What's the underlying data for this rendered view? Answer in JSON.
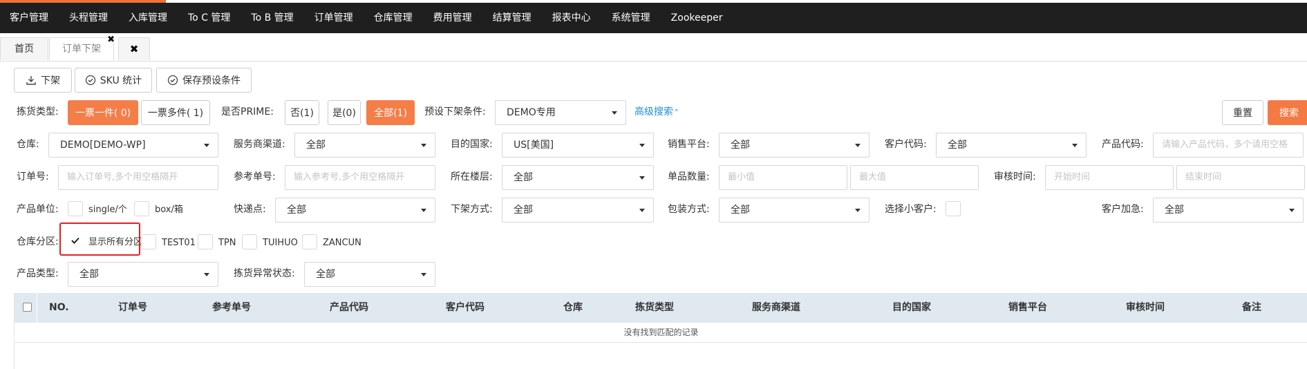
{
  "topnav": {
    "items": [
      "客户管理",
      "头程管理",
      "入库管理",
      "To C 管理",
      "To B 管理",
      "订单管理",
      "仓库管理",
      "费用管理",
      "结算管理",
      "报表中心",
      "系统管理",
      "Zookeeper"
    ]
  },
  "tabs": {
    "home": "首页",
    "current": "订单下架",
    "close_icon": "✖",
    "close_all": "✖"
  },
  "toolbar": {
    "offshelf": "下架",
    "sku_stats": "SKU 统计",
    "save_preset": "保存预设条件"
  },
  "filters": {
    "pick_type_label": "拣货类型:",
    "pick_type_options": [
      "一票一件( 0)",
      "一票多件( 1)"
    ],
    "prime_label": "是否PRIME:",
    "prime_options": [
      "否(1)",
      "是(0)",
      "全部(1)"
    ],
    "preset_label": "预设下架条件:",
    "preset_value": "DEMO专用",
    "advanced_search": "高级搜索",
    "reset": "重置",
    "search": "搜索",
    "warehouse_label": "仓库:",
    "warehouse_value": "DEMO[DEMO-WP]",
    "channel_label": "服务商渠道:",
    "channel_value": "全部",
    "country_label": "目的国家:",
    "country_value": "US[美国]",
    "platform_label": "销售平台:",
    "platform_value": "全部",
    "customer_code_label": "客户代码:",
    "customer_code_value": "全部",
    "product_code_label": "产品代码:",
    "product_code_placeholder": "请输入产品代码，多个请用空格",
    "order_no_label": "订单号:",
    "order_no_placeholder": "输入订单号,多个用空格隔开",
    "ref_no_label": "参考单号:",
    "ref_no_placeholder": "输入参考号,多个用空格隔开",
    "floor_label": "所在楼层:",
    "floor_value": "全部",
    "qty_label": "单品数量:",
    "qty_min_placeholder": "最小值",
    "qty_max_placeholder": "最大值",
    "audit_time_label": "审核时间:",
    "audit_start_placeholder": "开始时间",
    "audit_end_placeholder": "结束时间",
    "unit_label": "产品单位:",
    "unit_single": "single/个",
    "unit_box": "box/箱",
    "express_label": "快递点:",
    "express_value": "全部",
    "offshelf_method_label": "下架方式:",
    "offshelf_method_value": "全部",
    "pack_method_label": "包装方式:",
    "pack_method_value": "全部",
    "small_customer_label": "选择小客户:",
    "urgent_label": "客户加急:",
    "urgent_value": "全部",
    "zone_label": "仓库分区:",
    "zone_show_all": "显示所有分区",
    "zone_show_all_checked": true,
    "zones": [
      "TEST01",
      "TPN",
      "TUIHUO",
      "ZANCUN"
    ],
    "product_type_label": "产品类型:",
    "product_type_value": "全部",
    "pick_exception_label": "拣货异常状态:",
    "pick_exception_value": "全部"
  },
  "table": {
    "columns": [
      "NO.",
      "订单号",
      "参考单号",
      "产品代码",
      "客户代码",
      "仓库",
      "拣货类型",
      "服务商渠道",
      "目的国家",
      "销售平台",
      "审核时间",
      "备注"
    ],
    "empty_text": "没有找到匹配的记录"
  },
  "colors": {
    "accent": "#f57d47",
    "nav_bg": "#1f1f1f",
    "link": "#1e8fd4",
    "table_header": "#dfe9ef",
    "highlight": "#e81d1d"
  }
}
